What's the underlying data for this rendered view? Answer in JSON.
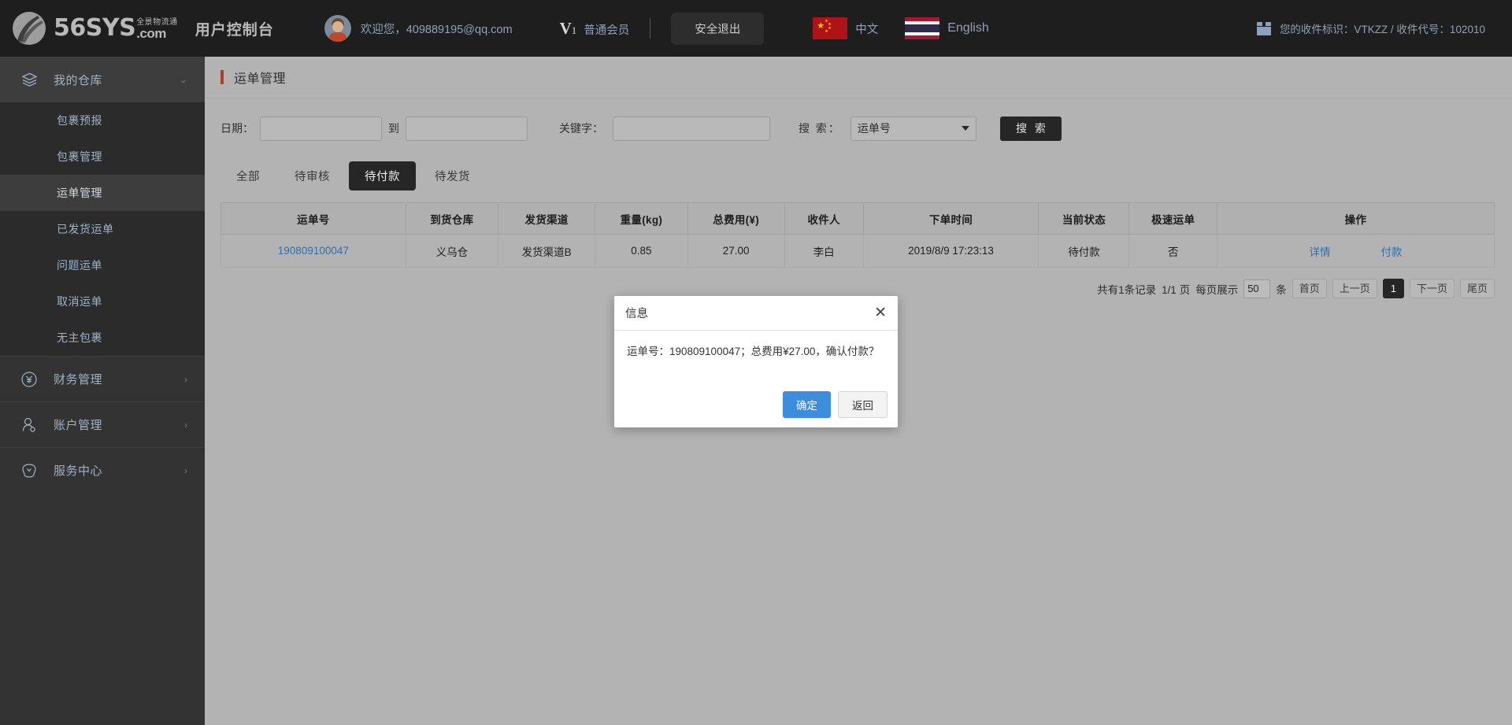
{
  "header": {
    "logo": {
      "brand": "56SYS",
      "brand_cn": "全景物流通",
      "domain": ".com"
    },
    "console_title": "用户控制台",
    "welcome": "欢迎您，409889195@qq.com",
    "vip_v": "V",
    "vip_level": "1",
    "member_label": "普通会员",
    "logout_label": "安全退出",
    "lang_cn": "中文",
    "lang_en": "English",
    "receiver_info": "您的收件标识：VTKZZ / 收件代号：102010"
  },
  "sidebar": {
    "groups": [
      {
        "label": "我的仓库",
        "icon": "layers-icon",
        "arrow": "chevron-down-icon",
        "expanded": true,
        "items": [
          {
            "label": "包裹预报",
            "active": false
          },
          {
            "label": "包裹管理",
            "active": false
          },
          {
            "label": "运单管理",
            "active": true
          },
          {
            "label": "已发货运单",
            "active": false
          },
          {
            "label": "问题运单",
            "active": false
          },
          {
            "label": "取消运单",
            "active": false
          },
          {
            "label": "无主包裹",
            "active": false
          }
        ]
      },
      {
        "label": "财务管理",
        "icon": "yen-circle-icon",
        "arrow": "chevron-right-icon",
        "expanded": false,
        "items": []
      },
      {
        "label": "账户管理",
        "icon": "user-icon",
        "arrow": "chevron-right-icon",
        "expanded": false,
        "items": []
      },
      {
        "label": "服务中心",
        "icon": "support-icon",
        "arrow": "chevron-right-icon",
        "expanded": false,
        "items": []
      }
    ]
  },
  "main": {
    "page_title": "运单管理",
    "filters": {
      "date_label": "日期：",
      "date_from": "",
      "date_to": "",
      "between_label": "到",
      "keyword_label": "关键字：",
      "keyword": "",
      "search_label": "搜 索：",
      "search_field_selected": "运单号",
      "search_button": "搜 索"
    },
    "tabs": [
      {
        "label": "全部",
        "active": false
      },
      {
        "label": "待审核",
        "active": false
      },
      {
        "label": "待付款",
        "active": true
      },
      {
        "label": "待发货",
        "active": false
      }
    ],
    "table": {
      "columns": [
        "运单号",
        "到货仓库",
        "发货渠道",
        "重量(kg)",
        "总费用(¥)",
        "收件人",
        "下单时间",
        "当前状态",
        "极速运单",
        "操作"
      ],
      "rows": [
        {
          "waybill_no": "190809100047",
          "warehouse": "义乌仓",
          "channel": "发货渠道B",
          "weight": "0.85",
          "total_fee": "27.00",
          "receiver": "李白",
          "order_time": "2019/8/9 17:23:13",
          "status": "待付款",
          "express": "否",
          "actions": [
            "详情",
            "付款"
          ]
        }
      ]
    },
    "pagination": {
      "total_text": "共有1条记录",
      "page_text": "1/1 页",
      "per_page_label": "每页展示",
      "per_page_value": "50",
      "unit": "条",
      "first": "首页",
      "prev": "上一页",
      "current": "1",
      "next": "下一页",
      "last": "尾页"
    }
  },
  "modal": {
    "title": "信息",
    "close_icon": "close-icon",
    "message": "运单号：190809100047；总费用¥27.00，确认付款？",
    "confirm_label": "确定",
    "cancel_label": "返回"
  },
  "colors": {
    "header_bg": "#1e1e1e",
    "sidebar_bg": "#333333",
    "sidebar_active": "#3d3d3d",
    "page_bg": "#b3b3b3",
    "accent_red": "#a84526",
    "link_blue": "#2f6fa8",
    "primary_blue": "#3c8dde",
    "tab_active_bg": "#262626"
  }
}
